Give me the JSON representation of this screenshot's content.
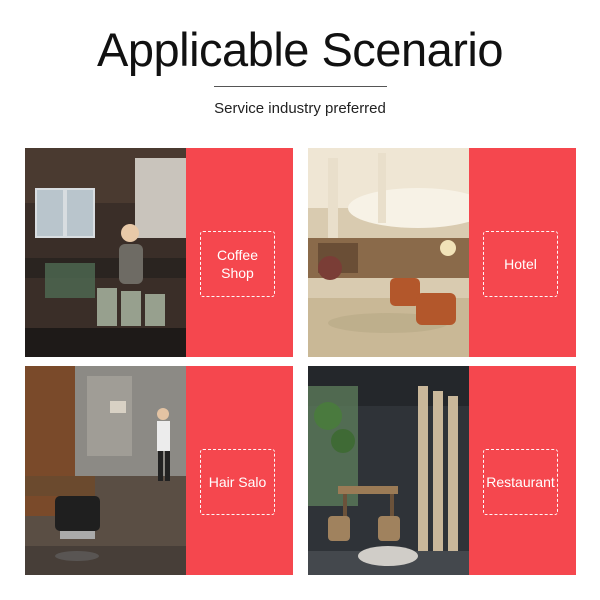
{
  "header": {
    "title": "Applicable Scenario",
    "subtitle": "Service industry preferred"
  },
  "cards": [
    {
      "label": "Coffee\nShop",
      "label_lines": [
        "Coffee",
        "Shop"
      ],
      "photo": "coffee-shop-photo"
    },
    {
      "label": "Hotel",
      "label_lines": [
        "Hotel"
      ],
      "photo": "hotel-lobby-photo"
    },
    {
      "label": "Hair Salo",
      "label_lines": [
        "Hair Salo"
      ],
      "photo": "hair-salon-photo"
    },
    {
      "label": "Restaurant",
      "label_lines": [
        "Restaurant"
      ],
      "photo": "restaurant-photo"
    }
  ],
  "colors": {
    "panel": "#f5474e",
    "label_border": "#ffffff",
    "title": "#111111"
  }
}
